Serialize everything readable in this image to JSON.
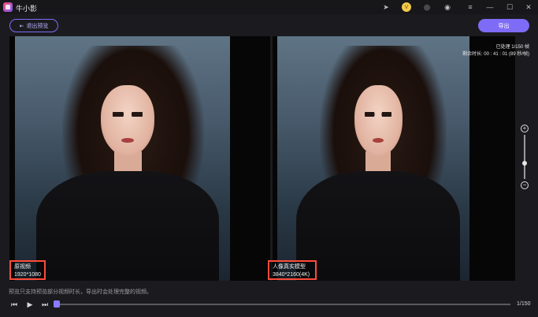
{
  "window": {
    "title": "牛小影",
    "icons": [
      "send-icon",
      "vip-icon",
      "headset-icon",
      "coin-icon",
      "menu-icon",
      "minimize-icon",
      "maximize-icon",
      "close-icon"
    ]
  },
  "toolbar": {
    "exit_label": "退出预览",
    "export_label": "导出"
  },
  "preview": {
    "left": {
      "label": "原视频",
      "resolution": "1920*1080"
    },
    "right": {
      "label": "人像真实模型",
      "resolution": "3840*2160(4K)",
      "processed": "已处理 1/150 帧",
      "remaining": "剩余时长: 00 : 41 : 01 (89 秒/帧)"
    }
  },
  "zoom": {
    "plus": "+",
    "minus": "−"
  },
  "bottom": {
    "notice": "预览只支持预览部分视频时长，导出时会处理完整的视频。",
    "frame_count": "1/150"
  },
  "colors": {
    "accent": "#7e6cf6",
    "highlight": "#ff4b3a"
  }
}
